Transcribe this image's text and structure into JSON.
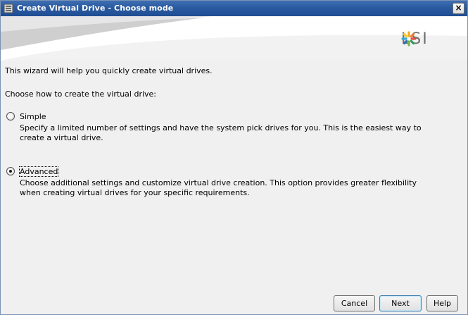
{
  "window": {
    "title": "Create Virtual Drive - Choose mode",
    "close_label": "×"
  },
  "banner": {
    "logo_text": "LSI",
    "logo_icon": "lsi-star-icon"
  },
  "content": {
    "intro": "This wizard will help you quickly create virtual drives.",
    "prompt": "Choose how to create the virtual drive:",
    "options": [
      {
        "label": "Simple",
        "selected": false,
        "description": "Specify a limited number of settings and have the system pick drives for you. This is the easiest way to create a virtual drive."
      },
      {
        "label": "Advanced",
        "selected": true,
        "description": "Choose additional settings and customize virtual drive creation. This option provides greater flexibility when creating virtual drives for your specific requirements."
      }
    ]
  },
  "buttons": {
    "cancel": "Cancel",
    "next": "Next",
    "help": "Help"
  },
  "colors": {
    "titlebar": "#2a5aa0",
    "dialog_bg": "#f0f0f0",
    "logo_gray": "#6e6e6e"
  }
}
